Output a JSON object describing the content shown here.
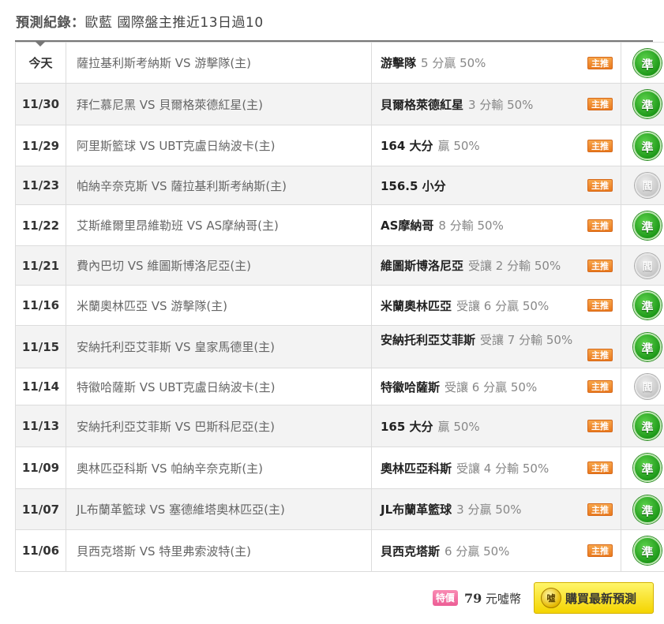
{
  "header": {
    "title_label": "預測紀錄：",
    "title_text": "歐藍 國際盤主推近13日過10"
  },
  "records": [
    {
      "date": "今天",
      "match": "薩拉基利斯考納斯 VS 游擊隊(主)",
      "pick_team": "游擊隊",
      "pick_detail": "5 分贏 50%",
      "tag": "主推",
      "result": "準",
      "result_type": "win"
    },
    {
      "date": "11/30",
      "match": "拜仁慕尼黑 VS 貝爾格萊德紅星(主)",
      "pick_team": "貝爾格萊德紅星",
      "pick_detail": "3 分輸 50%",
      "tag": "主推",
      "result": "準",
      "result_type": "win"
    },
    {
      "date": "11/29",
      "match": "阿里斯籃球 VS UBT克盧日納波卡(主)",
      "pick_team": "164 大分",
      "pick_detail": "贏 50%",
      "tag": "主推",
      "result": "準",
      "result_type": "win"
    },
    {
      "date": "11/23",
      "match": "帕納辛奈克斯 VS 薩拉基利斯考納斯(主)",
      "pick_team": "156.5 小分",
      "pick_detail": "",
      "tag": "主推",
      "result": "閻",
      "result_type": "push"
    },
    {
      "date": "11/22",
      "match": "艾斯維爾里昂維勒班 VS AS摩納哥(主)",
      "pick_team": "AS摩納哥",
      "pick_detail": "8 分輸 50%",
      "tag": "主推",
      "result": "準",
      "result_type": "win"
    },
    {
      "date": "11/21",
      "match": "費內巴切 VS 維圖斯博洛尼亞(主)",
      "pick_team": "維圖斯博洛尼亞",
      "pick_detail": "受讓 2 分輸 50%",
      "tag": "主推",
      "result": "閻",
      "result_type": "push"
    },
    {
      "date": "11/16",
      "match": "米蘭奧林匹亞 VS 游擊隊(主)",
      "pick_team": "米蘭奧林匹亞",
      "pick_detail": "受讓 6 分贏 50%",
      "tag": "主推",
      "result": "準",
      "result_type": "win"
    },
    {
      "date": "11/15",
      "match": "安納托利亞艾菲斯 VS 皇家馬德里(主)",
      "pick_team": "安納托利亞艾菲斯",
      "pick_detail": "受讓 7 分輸 50%",
      "tag": "主推",
      "result": "準",
      "result_type": "win"
    },
    {
      "date": "11/14",
      "match": "特徽哈薩斯 VS UBT克盧日納波卡(主)",
      "pick_team": "特徽哈薩斯",
      "pick_detail": "受讓 6 分贏 50%",
      "tag": "主推",
      "result": "閻",
      "result_type": "push"
    },
    {
      "date": "11/13",
      "match": "安納托利亞艾菲斯 VS 巴斯科尼亞(主)",
      "pick_team": "165 大分",
      "pick_detail": "贏 50%",
      "tag": "主推",
      "result": "準",
      "result_type": "win"
    },
    {
      "date": "11/09",
      "match": "奧林匹亞科斯 VS 帕納辛奈克斯(主)",
      "pick_team": "奧林匹亞科斯",
      "pick_detail": "受讓 4 分輸 50%",
      "tag": "主推",
      "result": "準",
      "result_type": "win"
    },
    {
      "date": "11/07",
      "match": "JL布蘭革籃球 VS 塞德維塔奧林匹亞(主)",
      "pick_team": "JL布蘭革籃球",
      "pick_detail": "3 分贏 50%",
      "tag": "主推",
      "result": "準",
      "result_type": "win"
    },
    {
      "date": "11/06",
      "match": "貝西克塔斯 VS 特里弗索波特(主)",
      "pick_team": "貝西克塔斯",
      "pick_detail": "6 分贏 50%",
      "tag": "主推",
      "result": "準",
      "result_type": "win"
    }
  ],
  "footer": {
    "special_label": "特價",
    "price_amount": "79",
    "price_unit": "元噓幣",
    "buy_icon_text": "噓",
    "buy_label": "購買最新預測"
  },
  "colors": {
    "win_badge": "#1f9a1a",
    "push_badge": "#c8c8c8",
    "tag_orange": "#ea7a1e",
    "buy_yellow": "#f4d400",
    "special_pink": "#ec5d95"
  }
}
